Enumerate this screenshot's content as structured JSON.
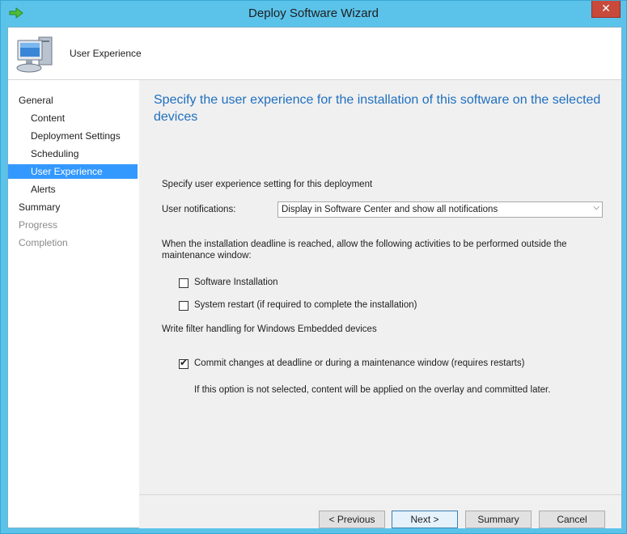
{
  "window": {
    "title": "Deploy Software Wizard",
    "close_label": "✕"
  },
  "header": {
    "title": "User Experience"
  },
  "nav": {
    "items": [
      {
        "label": "General"
      },
      {
        "label": "Content"
      },
      {
        "label": "Deployment Settings"
      },
      {
        "label": "Scheduling"
      },
      {
        "label": "User Experience"
      },
      {
        "label": "Alerts"
      },
      {
        "label": "Summary"
      },
      {
        "label": "Progress"
      },
      {
        "label": "Completion"
      }
    ],
    "selected": "User Experience"
  },
  "main": {
    "heading": "Specify the user experience for the installation of this software on the selected devices",
    "intro": "Specify user experience setting for this deployment",
    "notifications_label": "User notifications:",
    "notifications_value": "Display in Software Center and show all notifications",
    "deadline_text": "When the installation deadline is reached, allow the following activities to be performed outside the maintenance window:",
    "software_installation_label": "Software Installation",
    "software_installation_checked": false,
    "system_restart_label": "System restart  (if required to complete the installation)",
    "system_restart_checked": false,
    "write_filter_heading": "Write filter handling for Windows Embedded devices",
    "commit_label": "Commit changes at deadline or during a maintenance window (requires restarts)",
    "commit_checked": true,
    "commit_note": "If this option is not selected, content will be applied on the overlay and committed later."
  },
  "buttons": {
    "previous": "< Previous",
    "next": "Next >",
    "summary": "Summary",
    "cancel": "Cancel"
  },
  "colors": {
    "frame": "#5bc3ea",
    "selection": "#3399ff",
    "heading": "#1f6fbf"
  }
}
